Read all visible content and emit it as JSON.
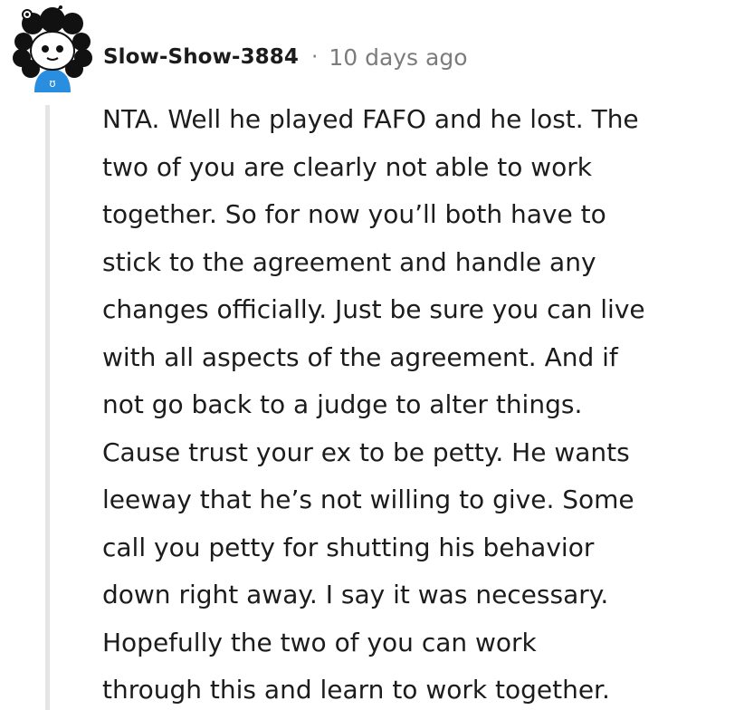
{
  "comment": {
    "username": "Slow-Show-3884",
    "separator": "·",
    "timestamp": "10 days ago",
    "avatar_icon": "snoo-avatar-icon",
    "body_lines": [
      "NTA. Well he played FAFO and he lost. The",
      "two of you are clearly not able to work",
      "together. So for now you’ll both have to",
      "stick to the agreement and handle any",
      "changes officially. Just be sure you can live",
      "with all aspects of the agreement. And if",
      "not go back to a judge to alter things.",
      "Cause trust your ex to be petty. He wants",
      "leeway that he’s not willing to give. Some",
      "call you petty for shutting his behavior",
      "down right away. I say it was necessary.",
      "Hopefully the two of you can work",
      "through this and learn to work together."
    ]
  },
  "colors": {
    "text": "#1c1c1c",
    "meta": "#7c7c7c",
    "thread_line": "#e5e5e5",
    "avatar_shirt": "#2a8ee0"
  }
}
